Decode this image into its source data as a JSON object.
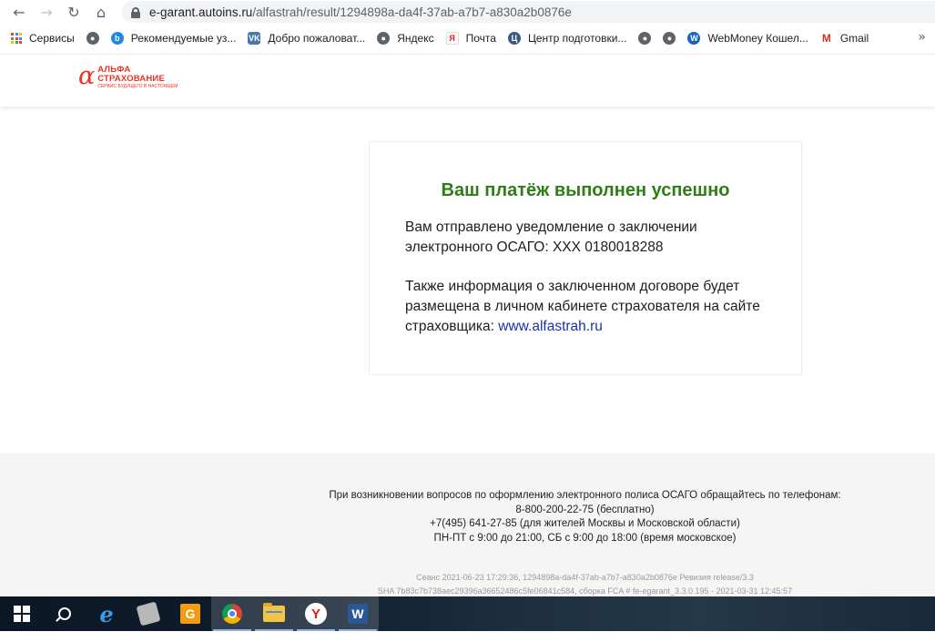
{
  "browser": {
    "url_host": "e-garant.autoins.ru",
    "url_path": "/alfastrah/result/1294898a-da4f-37ab-a7b7-a830a2b0876e"
  },
  "bookmarks": [
    {
      "label": "Сервисы",
      "icon": "apps-icon",
      "color": "#4285f4"
    },
    {
      "label": "",
      "icon": "globe-icon",
      "color": "#5f6368"
    },
    {
      "label": "Рекомендуемые уз...",
      "icon": "bing-icon",
      "color": "#1e88e5"
    },
    {
      "label": "Добро пожаловат...",
      "icon": "vk-icon",
      "color": "#4a76a8"
    },
    {
      "label": "Яндекс",
      "icon": "globe-icon",
      "color": "#5f6368"
    },
    {
      "label": "Почта",
      "icon": "yandex-icon",
      "color": "#e21b1b"
    },
    {
      "label": "Центр подготовки...",
      "icon": "site-icon",
      "color": "#3a5a8c"
    },
    {
      "label": "",
      "icon": "globe-icon",
      "color": "#5f6368"
    },
    {
      "label": "",
      "icon": "globe-icon",
      "color": "#5f6368"
    },
    {
      "label": "WebMoney Кошел...",
      "icon": "webmoney-icon",
      "color": "#1565c0"
    },
    {
      "label": "Gmail",
      "icon": "gmail-icon",
      "color": "#d93025"
    }
  ],
  "bookmarks_more": "»",
  "logo": {
    "alpha": "α",
    "line1": "АЛЬФА",
    "line2": "СТРАХОВАНИЕ",
    "tagline": "СЕРВИС БУДУЩЕГО В НАСТОЯЩЕМ"
  },
  "card": {
    "title": "Ваш платёж выполнен успешно",
    "p1": "Вам отправлено уведомление о заключении электронного ОСАГО: ХХХ 0180018288",
    "p2_text": "Также информация о заключенном договоре будет размещена в личном кабинете страхователя на сайте страховщика: ",
    "p2_link": "www.alfastrah.ru"
  },
  "footer": {
    "line1": "При возникновении вопросов по оформлению электронного полиса ОСАГО обращайтесь по телефонам:",
    "line2": "8-800-200-22-75 (бесплатно)",
    "line3": "+7(495) 641-27-85 (для жителей Москвы и Московской области)",
    "line4": "ПН-ПТ с 9:00 до 21:00, СБ с 9:00 до 18:00 (время московское)",
    "meta1": "Сеанс 2021-06-23 17:29:36, 1294898a-da4f-37ab-a7b7-a830a2b0876e  Ревизия release/3.3",
    "meta2": "SHA 7b83c7b738aec29396a36652486c5fe06841c584, сборка FCA # fe-egarant_3.3.0.195 - 2021-03-31 12:45:57"
  },
  "taskbar": {
    "g_label": "G",
    "yandex_label": "Y",
    "word_label": "W"
  },
  "colors": {
    "brand_red": "#ef3124",
    "success_green": "#2e7d16",
    "link_blue": "#1a33a0"
  }
}
